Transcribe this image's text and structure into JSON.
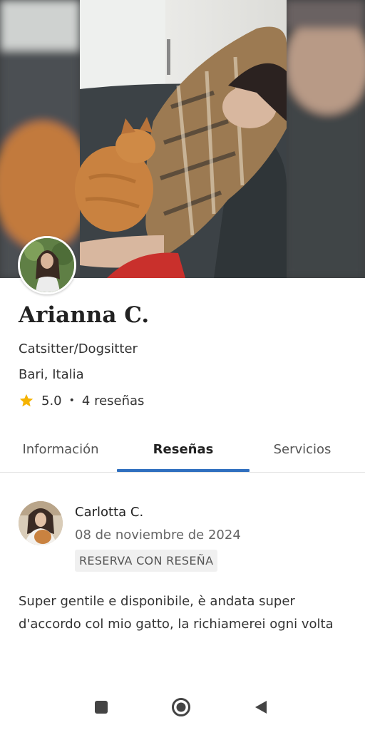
{
  "profile": {
    "name": "Arianna C.",
    "role": "Catsitter/Dogsitter",
    "location": "Bari, Italia",
    "rating": "5.0",
    "separator": "•",
    "reviews_count": "4 reseñas"
  },
  "tabs": [
    {
      "label": "Información",
      "active": false
    },
    {
      "label": "Reseñas",
      "active": true
    },
    {
      "label": "Servicios",
      "active": false
    }
  ],
  "review": {
    "author": "Carlotta C.",
    "date": "08 de noviembre de 2024",
    "badge": "RESERVA CON RESEÑA",
    "text": "Super gentile e disponibile, è andata super d'accordo col mio gatto, la richiamerei ogni volta"
  },
  "colors": {
    "accent": "#2f6fbf",
    "star": "#f5b301"
  },
  "icons": {
    "rating": "star-icon",
    "nav_recents": "square-icon",
    "nav_home": "circle-icon",
    "nav_back": "triangle-back-icon"
  }
}
